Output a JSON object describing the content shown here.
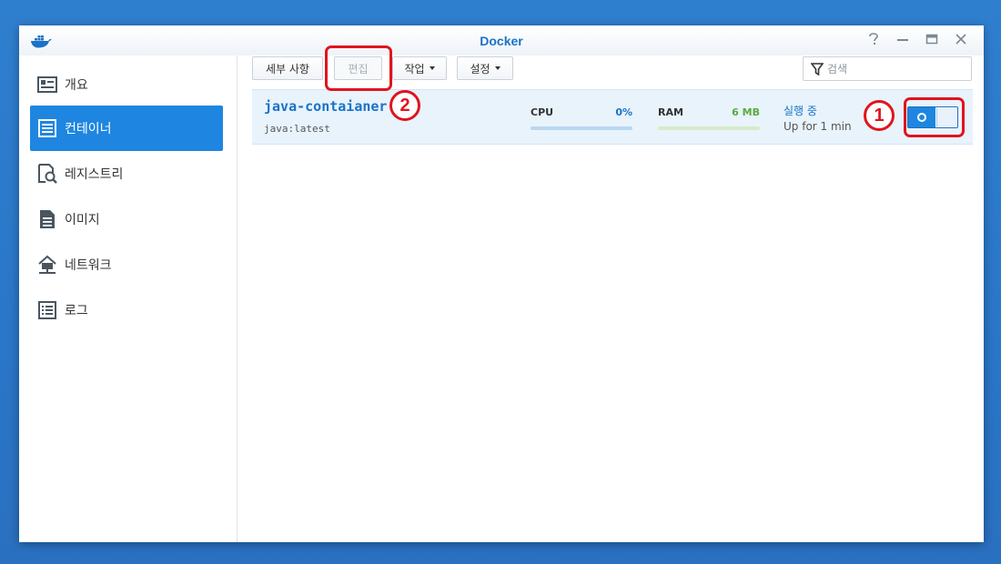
{
  "window": {
    "title": "Docker"
  },
  "sidebar": {
    "items": [
      {
        "label": "개요",
        "icon": "overview-icon",
        "active": false
      },
      {
        "label": "컨테이너",
        "icon": "container-icon",
        "active": true
      },
      {
        "label": "레지스트리",
        "icon": "registry-icon",
        "active": false
      },
      {
        "label": "이미지",
        "icon": "image-icon",
        "active": false
      },
      {
        "label": "네트워크",
        "icon": "network-icon",
        "active": false
      },
      {
        "label": "로그",
        "icon": "log-icon",
        "active": false
      }
    ]
  },
  "toolbar": {
    "details_label": "세부 사항",
    "edit_label": "편집",
    "action_label": "작업",
    "settings_label": "설정"
  },
  "search": {
    "placeholder": "검색"
  },
  "container": {
    "name": "java-contaianer",
    "image": "java:latest",
    "cpu_label": "CPU",
    "cpu_value": "0%",
    "cpu_fraction": 0.0,
    "ram_label": "RAM",
    "ram_value": "6 MB",
    "status": "실행 중",
    "uptime": "Up for 1 min",
    "running": true
  },
  "annotations": {
    "one": "1",
    "two": "2"
  },
  "colors": {
    "accent": "#1e86e0",
    "title": "#1a73c6",
    "ram": "#5aaa3c",
    "annotation": "#e0141e"
  }
}
